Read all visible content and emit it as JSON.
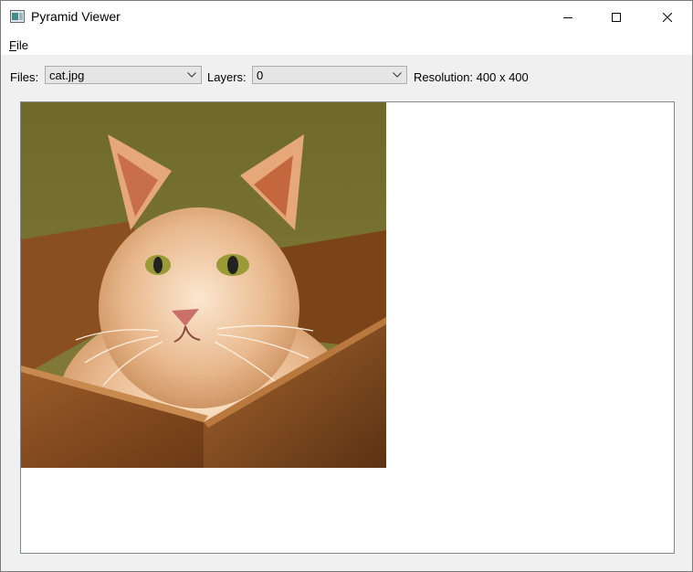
{
  "window": {
    "title": "Pyramid Viewer",
    "icons": {
      "app": "app-window-icon",
      "minimize": "minimize-icon",
      "maximize": "maximize-icon",
      "close": "close-icon"
    }
  },
  "menubar": {
    "items": [
      {
        "label_prefix": "",
        "mnemonic": "F",
        "label_rest": "ile"
      }
    ]
  },
  "toolbar": {
    "files_label": "Files:",
    "files_value": "cat.jpg",
    "layers_label": "Layers:",
    "layers_value": "0",
    "resolution_text": "Resolution: 400 x 400"
  },
  "viewer": {
    "image": {
      "subject": "cat-in-cardboard-box-photo"
    }
  },
  "colors": {
    "titlebar_bg": "#ffffff",
    "window_bg": "#f0f0f0",
    "combo_bg": "#e5e5e5",
    "combo_border": "#adadad",
    "view_border": "#828790"
  }
}
